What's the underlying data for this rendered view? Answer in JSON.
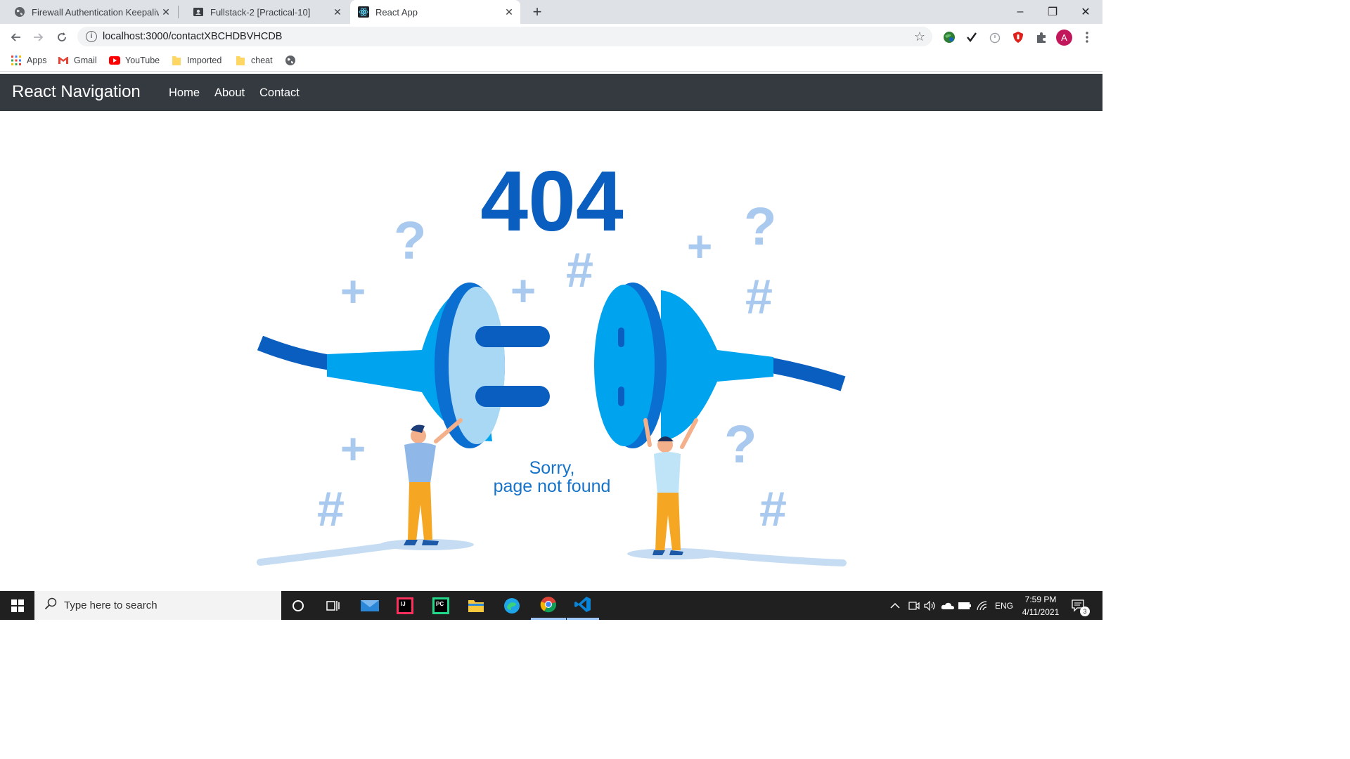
{
  "browser": {
    "tabs": [
      {
        "title": "Firewall Authentication Keepalive",
        "active": false,
        "icon": "globe-icon"
      },
      {
        "title": "Fullstack-2 [Practical-10]",
        "active": false,
        "icon": "contact-card-icon"
      },
      {
        "title": "React App",
        "active": true,
        "icon": "react-icon"
      }
    ],
    "new_tab_label": "+",
    "window_controls": {
      "minimize": "–",
      "maximize": "❐",
      "close": "✕"
    },
    "address": {
      "url": "localhost:3000/contactXBCHDBVHCDB",
      "info_icon": "i"
    },
    "profile_initial": "A",
    "bookmarks": [
      {
        "label": "Apps",
        "icon": "apps-grid-icon"
      },
      {
        "label": "Gmail",
        "icon": "gmail-icon"
      },
      {
        "label": "YouTube",
        "icon": "youtube-icon"
      },
      {
        "label": "Imported",
        "icon": "folder-icon"
      },
      {
        "label": "cheat",
        "icon": "folder-icon"
      }
    ]
  },
  "app": {
    "brand": "React Navigation",
    "nav": [
      {
        "label": "Home"
      },
      {
        "label": "About"
      },
      {
        "label": "Contact"
      }
    ],
    "error": {
      "code": "404",
      "message_line1": "Sorry,",
      "message_line2": "page not found",
      "colors": {
        "dark_blue": "#0a5ebf",
        "blue": "#00a3ee",
        "light_blue": "#a9d8f5",
        "pale": "#c5dcf3"
      }
    }
  },
  "taskbar": {
    "search_placeholder": "Type here to search",
    "language": "ENG",
    "time": "7:59 PM",
    "date": "4/11/2021",
    "notifications": "3"
  }
}
